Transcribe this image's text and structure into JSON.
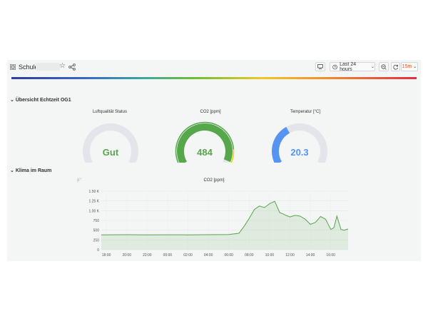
{
  "dashboard": {
    "title": "Schule",
    "time_range": "Last 24 hours",
    "refresh": "15m",
    "refresh_color": "#f5541c"
  },
  "icons": {
    "grid": "grid-icon",
    "star": "star-icon",
    "share": "share-icon",
    "tv": "tv-mode-icon",
    "clock": "clock-icon",
    "zoom": "zoom-out-icon",
    "refresh": "refresh-icon",
    "chevron": "chevron-down-icon"
  },
  "rows": [
    {
      "label": "Übersicht Echtzeit OG1"
    },
    {
      "label": "Klima im Raum"
    }
  ],
  "gauges": [
    {
      "title": "Luftqualität Status",
      "value": "Gut",
      "color": "#56a64b",
      "fill": 0
    },
    {
      "title": "CO2 [ppm]",
      "value": "484",
      "color": "#56a64b",
      "fill": 0.97
    },
    {
      "title": "Temperatur [°C]",
      "value": "20.3",
      "color": "#5794f2",
      "fill": 0.38
    }
  ],
  "chart_data": {
    "type": "line",
    "title": "CO2 [ppm]",
    "x_ticks": [
      "18:00",
      "20:00",
      "22:00",
      "00:00",
      "02:00",
      "04:00",
      "06:00",
      "08:00",
      "10:00",
      "12:00",
      "14:00",
      "16:00"
    ],
    "y_ticks": [
      "0",
      "250",
      "500",
      "750",
      "1.00 K",
      "1.25 K",
      "1.50 K"
    ],
    "ylim": [
      0,
      1500
    ],
    "x_hours_range": [
      17.5,
      41.7
    ],
    "series": [
      {
        "color": "#56a64b",
        "x": [
          17.5,
          20,
          22,
          24,
          26,
          28,
          30,
          31,
          31.5,
          32,
          32.5,
          33,
          33.5,
          34,
          34.5,
          35,
          35.3,
          35.6,
          36,
          36.5,
          37,
          37.5,
          38,
          38.5,
          39,
          39.5,
          40,
          40.3,
          40.6,
          41,
          41.3,
          41.7
        ],
        "y": [
          380,
          385,
          378,
          382,
          380,
          385,
          390,
          420,
          600,
          800,
          1030,
          1120,
          1080,
          1180,
          1240,
          950,
          920,
          880,
          840,
          880,
          860,
          780,
          650,
          700,
          850,
          780,
          520,
          560,
          860,
          520,
          500,
          530
        ]
      }
    ],
    "grid": true
  }
}
